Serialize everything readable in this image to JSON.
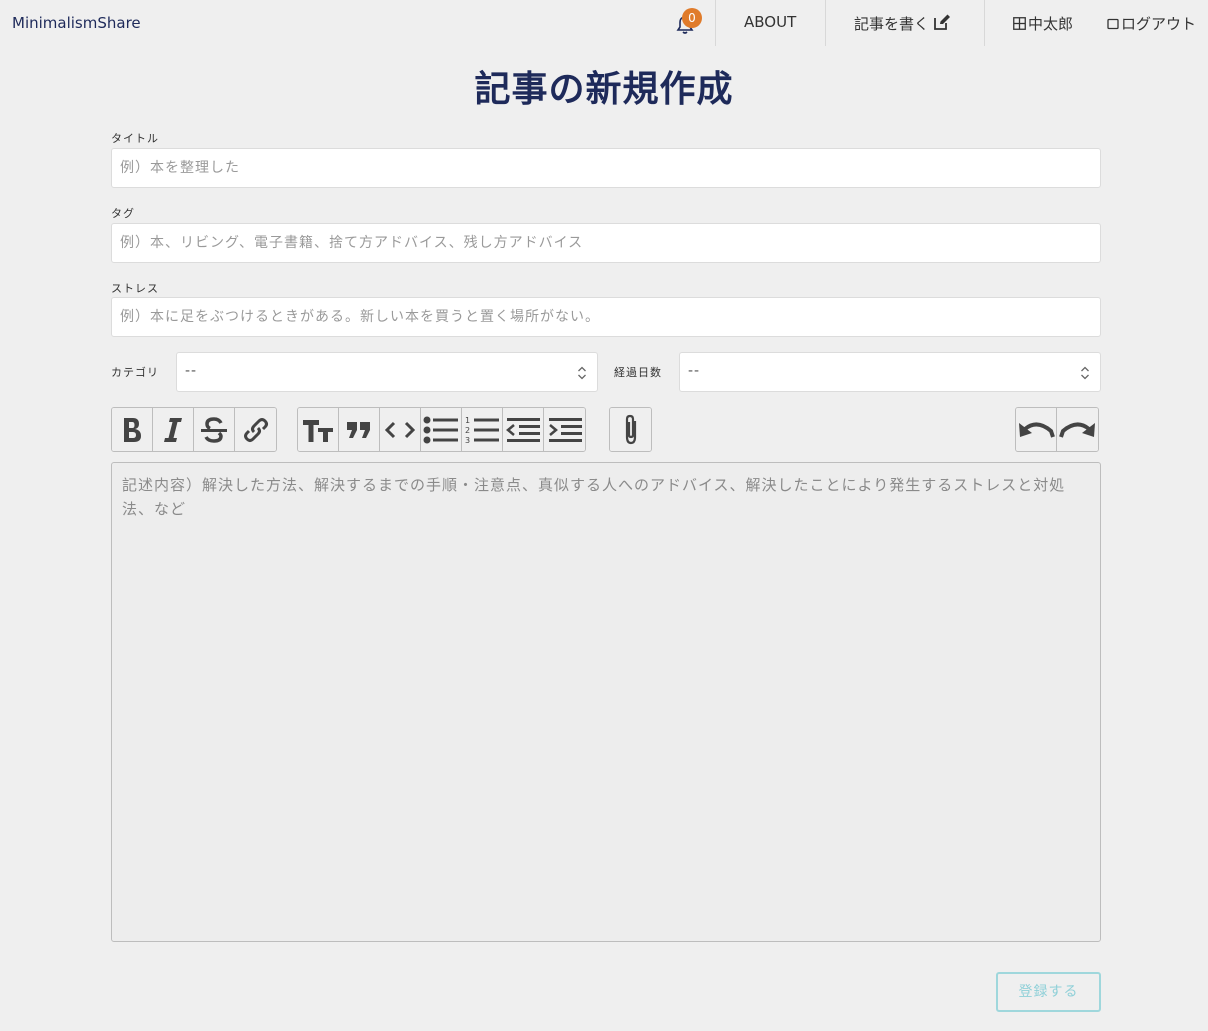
{
  "header": {
    "brand": "MinimalismShare",
    "notification_count": "0",
    "nav": {
      "about": "ABOUT",
      "write": "記事を書く",
      "user": "中太郎",
      "logout": "ログアウト"
    }
  },
  "page": {
    "title": "記事の新規作成"
  },
  "form": {
    "title": {
      "label": "タイトル",
      "placeholder": "例）本を整理した"
    },
    "tags": {
      "label": "タグ",
      "placeholder": "例）本、リビング、電子書籍、捨て方アドバイス、残し方アドバイス"
    },
    "stress": {
      "label": "ストレス",
      "placeholder": "例）本に足をぶつけるときがある。新しい本を買うと置く場所がない。"
    },
    "category": {
      "label": "カテゴリ",
      "value": "--"
    },
    "elapsed_days": {
      "label": "経過日数",
      "value": "--"
    },
    "editor_placeholder": "記述内容）解決した方法、解決するまでの手順・注意点、真似する人へのアドバイス、解決したことにより発生するストレスと対処法、など",
    "submit_label": "登録する"
  },
  "toolbar": {
    "icons": [
      "bold-icon",
      "italic-icon",
      "strikethrough-icon",
      "link-icon",
      "heading-icon",
      "quote-icon",
      "code-icon",
      "bullet-list-icon",
      "numbered-list-icon",
      "outdent-icon",
      "indent-icon",
      "attachment-icon",
      "undo-icon",
      "redo-icon"
    ]
  },
  "colors": {
    "background": "#efefef",
    "brand": "#1e2a5a",
    "badge": "#e07b2a",
    "submit": "#8fd0d8"
  }
}
